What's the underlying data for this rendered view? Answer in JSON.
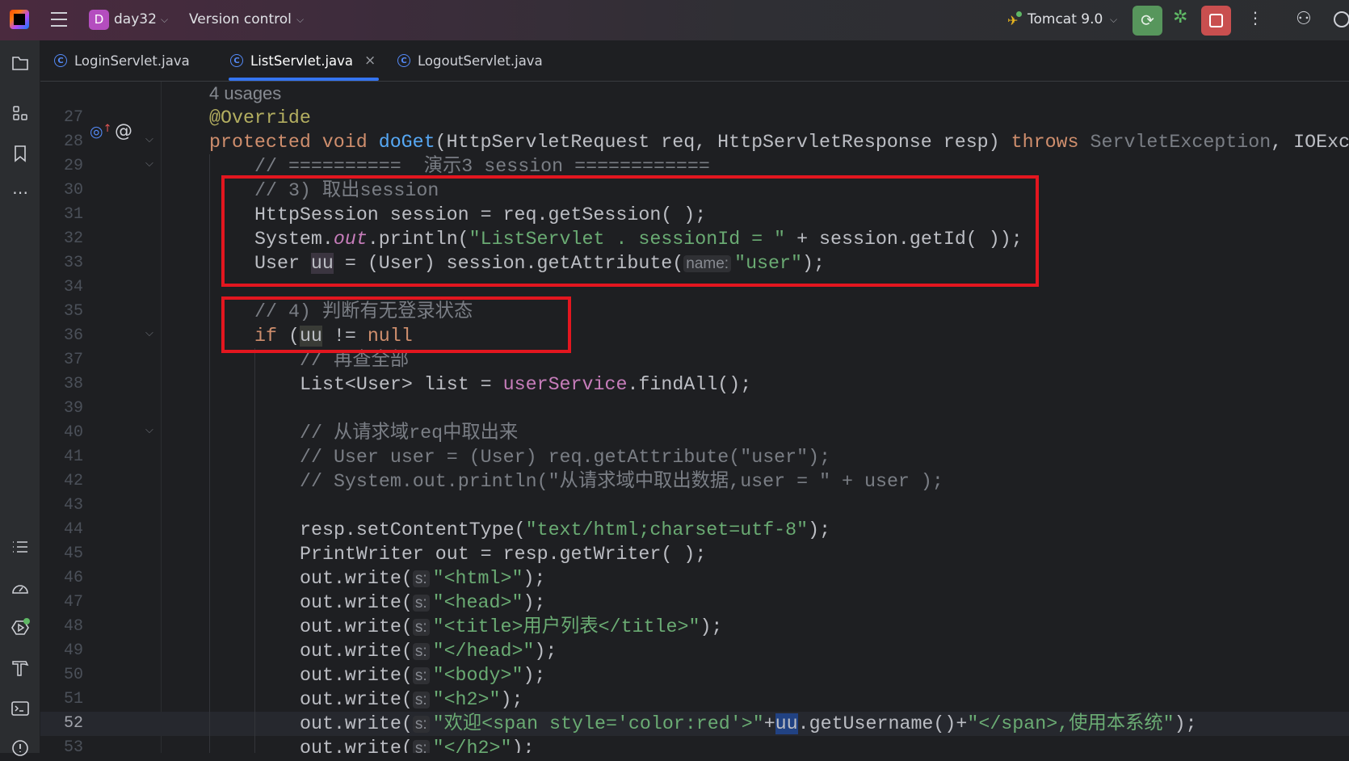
{
  "titlebar": {
    "project_initial": "D",
    "project": "day32",
    "vcs": "Version control",
    "run_config": "Tomcat 9.0"
  },
  "colors": {
    "accent": "#3574f0",
    "run": "#57965c",
    "stop": "#c94f4f",
    "annotation_box": "#e3161f"
  },
  "tabs": [
    {
      "label": "LoginServlet.java",
      "active": false
    },
    {
      "label": "ListServlet.java",
      "active": true,
      "close": "×"
    },
    {
      "label": "LogoutServlet.java",
      "active": false
    }
  ],
  "left_toolbar": {
    "top": [
      "folder-icon",
      "structure-icon",
      "bookmark-icon",
      "more-icon"
    ],
    "bottom": [
      "todo-icon",
      "profiler-icon",
      "services-icon",
      "build-icon",
      "terminal-icon",
      "problems-icon"
    ]
  },
  "editor": {
    "current_line": 52,
    "lines": [
      {
        "num": "",
        "indent": 0,
        "tokens": [
          [
            "usage",
            "4 usages"
          ]
        ]
      },
      {
        "num": "27",
        "indent": 0,
        "tokens": [
          [
            "ann",
            "@Override"
          ]
        ]
      },
      {
        "num": "28",
        "indent": 0,
        "fold": true,
        "tokens": [
          [
            "kw",
            "protected void "
          ],
          [
            "fn",
            "doGet"
          ],
          [
            "",
            "(HttpServletRequest req, HttpServletResponse resp) "
          ],
          [
            "kw",
            "throws "
          ],
          [
            "gray",
            "ServletException"
          ],
          [
            "",
            ", IOException {"
          ]
        ]
      },
      {
        "num": "29",
        "indent": 1,
        "fold": true,
        "tokens": [
          [
            "com",
            "// ==========  演示3 session ============"
          ]
        ]
      },
      {
        "num": "30",
        "indent": 1,
        "tokens": [
          [
            "com",
            "// 3) 取出session"
          ]
        ]
      },
      {
        "num": "31",
        "indent": 1,
        "tokens": [
          [
            "",
            "HttpSession session = req.getSession( );"
          ]
        ]
      },
      {
        "num": "32",
        "indent": 1,
        "tokens": [
          [
            "",
            "System."
          ],
          [
            "fld",
            "out"
          ],
          [
            "",
            ".println("
          ],
          [
            "str",
            "\"ListServlet . sessionId = \""
          ],
          [
            "",
            " + session.getId( ));"
          ]
        ]
      },
      {
        "num": "33",
        "indent": 1,
        "tokens": [
          [
            "",
            "User "
          ],
          [
            "hl",
            "uu"
          ],
          [
            "",
            " = (User) session.getAttribute("
          ],
          [
            "hint",
            "name:"
          ],
          [
            "str",
            "\"user\""
          ],
          [
            "",
            ");"
          ]
        ]
      },
      {
        "num": "34",
        "indent": 1,
        "tokens": []
      },
      {
        "num": "35",
        "indent": 1,
        "tokens": [
          [
            "com",
            "// 4) 判断有无登录状态"
          ]
        ]
      },
      {
        "num": "36",
        "indent": 1,
        "fold": true,
        "tokens": [
          [
            "kw",
            "if "
          ],
          [
            "",
            "("
          ],
          [
            "hl2",
            "uu"
          ],
          [
            "",
            " != "
          ],
          [
            "kw",
            "null"
          ],
          [
            ") {"
          ]
        ]
      },
      {
        "num": "37",
        "indent": 2,
        "tokens": [
          [
            "com",
            "// 再查全部"
          ]
        ]
      },
      {
        "num": "38",
        "indent": 2,
        "tokens": [
          [
            "",
            "List<User> list = "
          ],
          [
            "fld2",
            "userService"
          ],
          [
            "",
            ".findAll();"
          ]
        ]
      },
      {
        "num": "39",
        "indent": 2,
        "tokens": []
      },
      {
        "num": "40",
        "indent": 2,
        "fold": true,
        "tokens": [
          [
            "com",
            "// 从请求域req中取出来"
          ]
        ]
      },
      {
        "num": "41",
        "indent": 2,
        "tokens": [
          [
            "com",
            "// User user = (User) req.getAttribute(\"user\");"
          ]
        ]
      },
      {
        "num": "42",
        "indent": 2,
        "tokens": [
          [
            "com",
            "// System.out.println(\"从请求域中取出数据,user = \" + user );"
          ]
        ]
      },
      {
        "num": "43",
        "indent": 2,
        "tokens": []
      },
      {
        "num": "44",
        "indent": 2,
        "tokens": [
          [
            "",
            "resp.setContentType("
          ],
          [
            "str",
            "\"text/html;charset=utf-8\""
          ],
          [
            "",
            ");"
          ]
        ]
      },
      {
        "num": "45",
        "indent": 2,
        "tokens": [
          [
            "",
            "PrintWriter out = resp.getWriter( );"
          ]
        ]
      },
      {
        "num": "46",
        "indent": 2,
        "tokens": [
          [
            "",
            "out.write("
          ],
          [
            "hint",
            "s:"
          ],
          [
            "str",
            "\"<html>\""
          ],
          [
            "",
            ");"
          ]
        ]
      },
      {
        "num": "47",
        "indent": 2,
        "tokens": [
          [
            "",
            "out.write("
          ],
          [
            "hint",
            "s:"
          ],
          [
            "str",
            "\"<head>\""
          ],
          [
            "",
            ");"
          ]
        ]
      },
      {
        "num": "48",
        "indent": 2,
        "tokens": [
          [
            "",
            "out.write("
          ],
          [
            "hint",
            "s:"
          ],
          [
            "str",
            "\"<title>用户列表</title>\""
          ],
          [
            "",
            ");"
          ]
        ]
      },
      {
        "num": "49",
        "indent": 2,
        "tokens": [
          [
            "",
            "out.write("
          ],
          [
            "hint",
            "s:"
          ],
          [
            "str",
            "\"</head>\""
          ],
          [
            "",
            ");"
          ]
        ]
      },
      {
        "num": "50",
        "indent": 2,
        "tokens": [
          [
            "",
            "out.write("
          ],
          [
            "hint",
            "s:"
          ],
          [
            "str",
            "\"<body>\""
          ],
          [
            "",
            ");"
          ]
        ]
      },
      {
        "num": "51",
        "indent": 2,
        "tokens": [
          [
            "",
            "out.write("
          ],
          [
            "hint",
            "s:"
          ],
          [
            "str",
            "\"<h2>\""
          ],
          [
            "",
            ");"
          ]
        ]
      },
      {
        "num": "52",
        "indent": 2,
        "tokens": [
          [
            "",
            "out.write("
          ],
          [
            "hint",
            "s:"
          ],
          [
            "str",
            "\"欢迎<span style='color:red'>\""
          ],
          [
            "",
            "+"
          ],
          [
            "sel",
            "uu"
          ],
          [
            "",
            ".getUsername()+"
          ],
          [
            "str",
            "\"</span>,使用本系统\""
          ],
          [
            "",
            ");"
          ]
        ]
      },
      {
        "num": "53",
        "indent": 2,
        "tokens": [
          [
            "",
            "out.write("
          ],
          [
            "hint",
            "s:"
          ],
          [
            "str",
            "\"</h2>\""
          ],
          [
            "",
            ");"
          ]
        ]
      }
    ]
  }
}
